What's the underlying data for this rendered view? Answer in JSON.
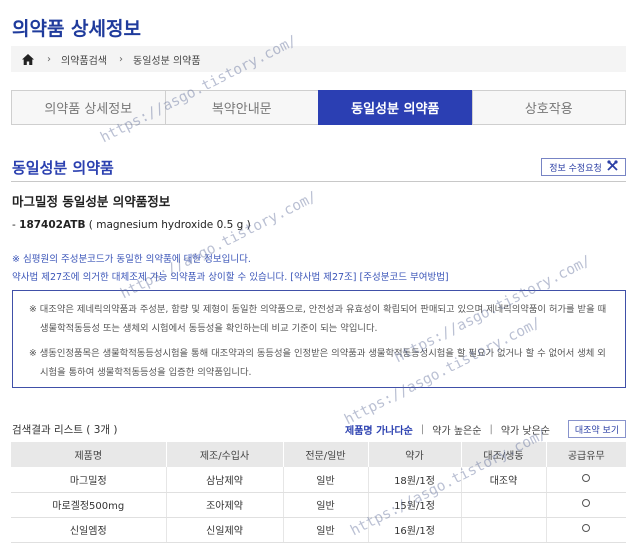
{
  "page": {
    "title": "의약품 상세정보"
  },
  "breadcrumb": {
    "items": [
      "의약품검색",
      "동일성분 의약품"
    ]
  },
  "tabs": [
    {
      "label": "의약품 상세정보",
      "active": false
    },
    {
      "label": "복약안내문",
      "active": false
    },
    {
      "label": "동일성분 의약품",
      "active": true
    },
    {
      "label": "상호작용",
      "active": false
    }
  ],
  "section": {
    "title": "동일성분 의약품",
    "edit_button": "정보 수정요청"
  },
  "info": {
    "title": "마그밀정 동일성분 의약품정보",
    "code_prefix": "- ",
    "code": "187402ATB",
    "ingredient": " ( magnesium hydroxide 0.5 g )"
  },
  "notes": {
    "line1": "※ 심평원의 주성분코드가 동일한 의약품에 대한 정보입니다.",
    "line2": "약사법 제27조에 의거한 대체조제 가능 의약품과 상이할 수 있습니다.",
    "link1": "[약사법 제27조]",
    "link2": "[주성분코드 부여방법]"
  },
  "notice": {
    "p1": "※ 대조약은 제네릭의약품과 주성분, 함량 및 제형이 동일한 의약품으로, 안전성과 유효성이 확립되어 판매되고 있으며 제네릭의약품이 허가를 받을 때 생물학적동등성 또는 생체외 시험에서 동등성을 확인하는데 비교 기준이 되는 약입니다.",
    "p2": "※ 생동인정품목은 생물학적동등성시험을 통해 대조약과의 동등성을 인정받은 의약품과 생물학적동등성시험을 할 필요가 없거나 할 수 없어서 생체 외 시험을 통하여 생물학적동등성을 입증한 의약품입니다."
  },
  "results": {
    "count_label": "검색결과 리스트 ( 3개 )",
    "sort_name": "제품명 가나다순",
    "sort_high": "약가 높은순",
    "sort_low": "약가 낮은순",
    "compare_button": "대조약 보기"
  },
  "table": {
    "headers": [
      "제품명",
      "제조/수입사",
      "전문/일반",
      "약가",
      "대조/생동",
      "공급유무"
    ],
    "rows": [
      {
        "name": "마그밀정",
        "maker": "삼남제약",
        "type": "일반",
        "price": "18원/1정",
        "ref": "대조약",
        "supply": "circle"
      },
      {
        "name": "마로겔정500mg",
        "maker": "조아제약",
        "type": "일반",
        "price": "15원/1정",
        "ref": "",
        "supply": "circle"
      },
      {
        "name": "신일엠정",
        "maker": "신일제약",
        "type": "일반",
        "price": "16원/1정",
        "ref": "",
        "supply": "circle"
      }
    ]
  },
  "watermark": {
    "text": "https://asgo.tistory.com/"
  }
}
